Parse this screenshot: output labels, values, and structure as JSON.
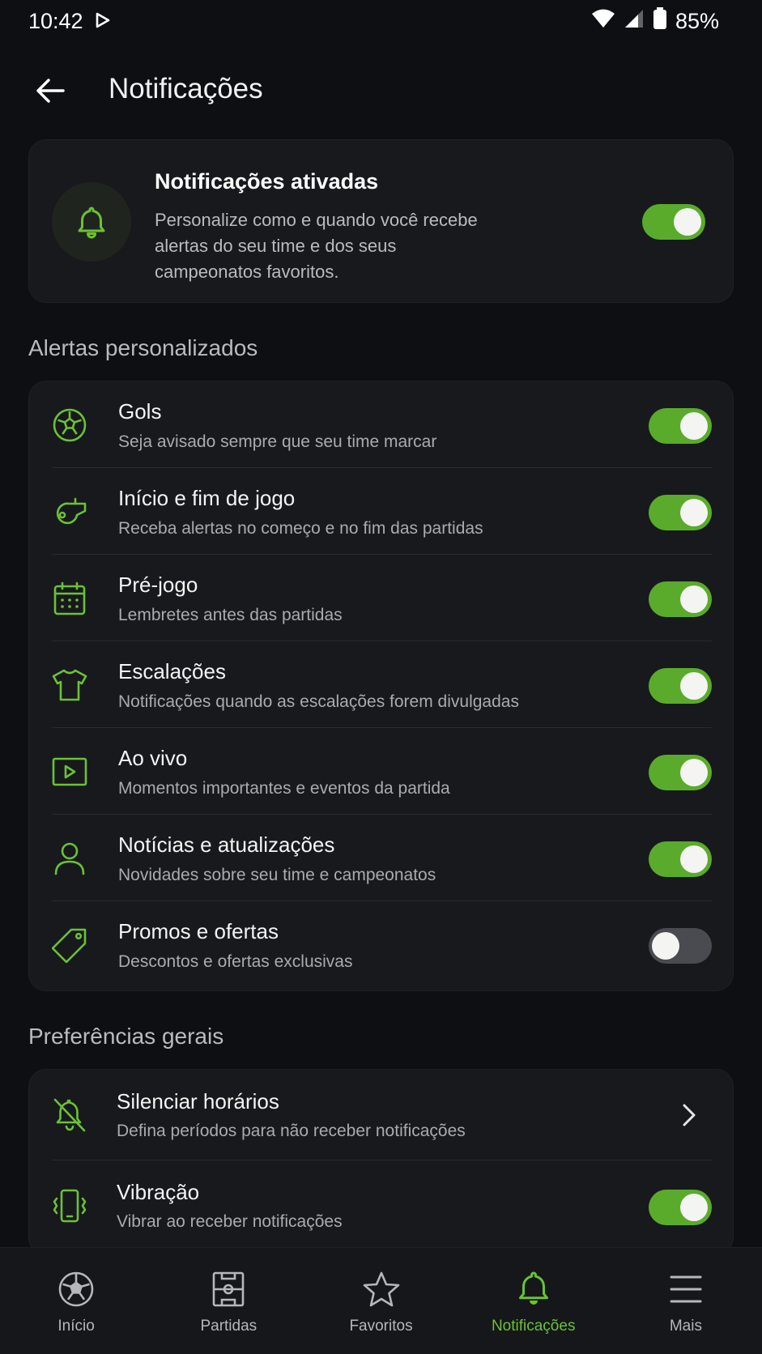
{
  "status": {
    "time": "10:42",
    "battery": "85%"
  },
  "header": {
    "title": "Notificações"
  },
  "hero": {
    "title": "Notificações ativadas",
    "description": "Personalize como e quando você recebe alertas do seu time e dos seus campeonatos favoritos.",
    "enabled": true
  },
  "alerts": {
    "section_title": "Alertas personalizados",
    "items": [
      {
        "icon": "soccer-ball-icon",
        "title": "Gols",
        "subtitle": "Seja avisado sempre que seu time marcar",
        "enabled": true
      },
      {
        "icon": "whistle-icon",
        "title": "Início e fim de jogo",
        "subtitle": "Receba alertas no começo e no fim das partidas",
        "enabled": true
      },
      {
        "icon": "calendar-icon",
        "title": "Pré-jogo",
        "subtitle": "Lembretes antes das partidas",
        "enabled": true
      },
      {
        "icon": "shirt-icon",
        "title": "Escalações",
        "subtitle": "Notificações quando as escalações forem divulgadas",
        "enabled": true
      },
      {
        "icon": "play-icon",
        "title": "Ao vivo",
        "subtitle": "Momentos importantes e eventos da partida",
        "enabled": true
      },
      {
        "icon": "person-icon",
        "title": "Notícias e atualizações",
        "subtitle": "Novidades sobre seu time e campeonatos",
        "enabled": true
      },
      {
        "icon": "tag-icon",
        "title": "Promos e ofertas",
        "subtitle": "Descontos e ofertas exclusivas",
        "enabled": false
      }
    ]
  },
  "preferences": {
    "section_title": "Preferências gerais",
    "items": [
      {
        "icon": "bell-off-icon",
        "title": "Silenciar horários",
        "subtitle": "Defina períodos para não receber notificações"
      },
      {
        "icon": "vibration-icon",
        "title": "Vibração",
        "subtitle": "Vibrar ao receber notificações",
        "enabled": true
      }
    ]
  },
  "nav": {
    "items": [
      {
        "label": "Início",
        "icon": "soccer-ball-icon"
      },
      {
        "label": "Partidas",
        "icon": "field-icon"
      },
      {
        "label": "Favoritos",
        "icon": "star-icon"
      },
      {
        "label": "Notificações",
        "icon": "bell-icon",
        "active": true
      },
      {
        "label": "Mais",
        "icon": "menu-icon"
      }
    ]
  },
  "colors": {
    "accent": "#6bc234",
    "toggle_on": "#5aab2b",
    "background": "#0e0f12",
    "card": "#18191d"
  }
}
